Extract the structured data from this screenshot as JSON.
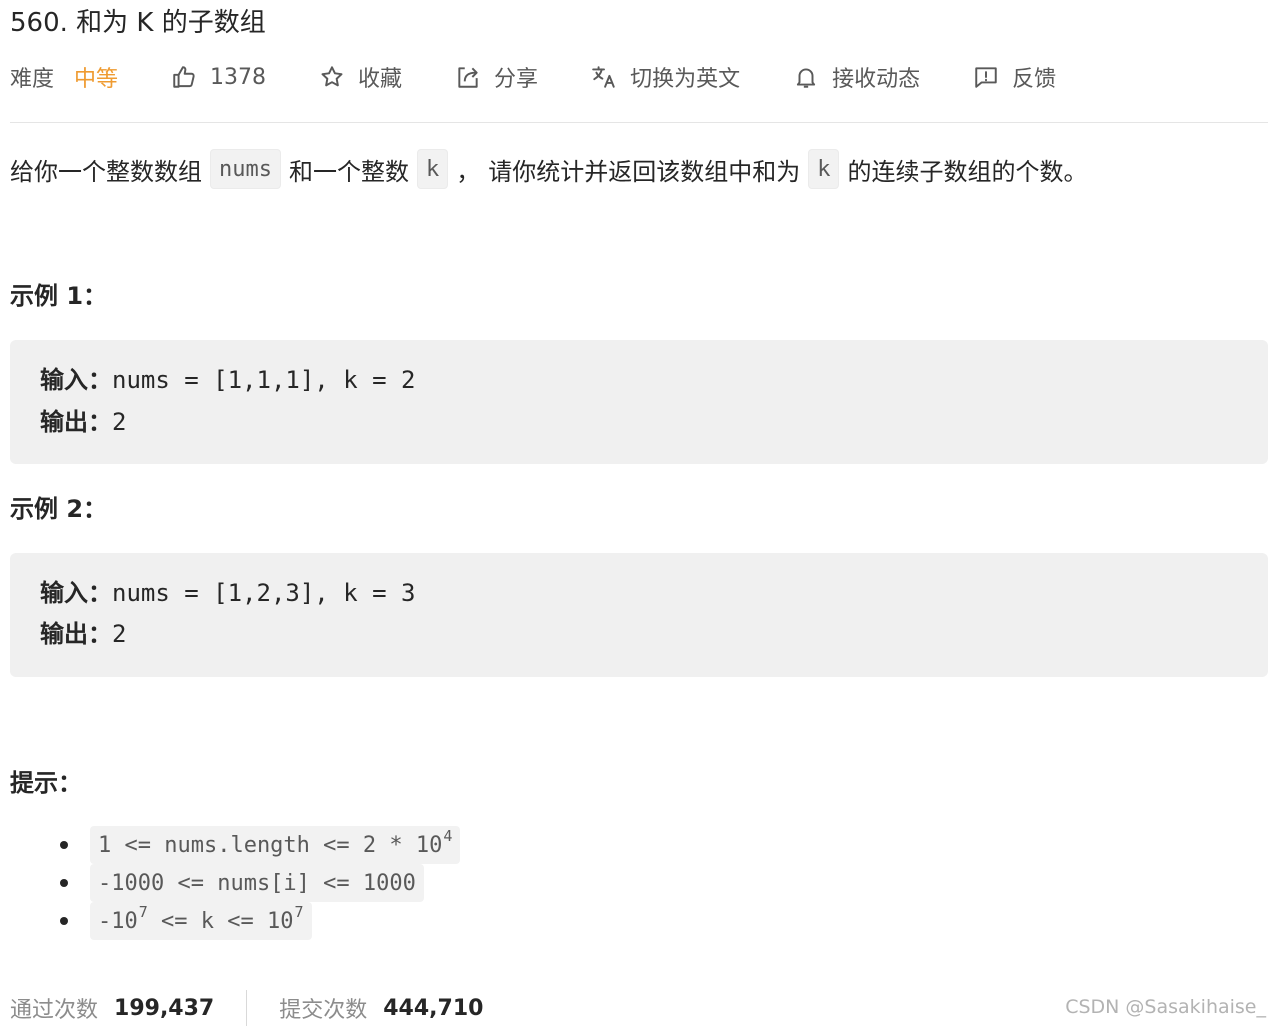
{
  "problem": {
    "title": "560. 和为 K 的子数组"
  },
  "toolbar": {
    "difficulty_label": "难度",
    "difficulty_value": "中等",
    "difficulty_color": "#ef9b31",
    "like_count": "1378",
    "like_icon": "thumbs-up-icon",
    "favorite_label": "收藏",
    "favorite_icon": "star-icon",
    "share_label": "分享",
    "share_icon": "share-icon",
    "translate_label": "切换为英文",
    "translate_icon": "translate-icon",
    "subscribe_label": "接收动态",
    "subscribe_icon": "bell-icon",
    "feedback_label": "反馈",
    "feedback_icon": "feedback-icon"
  },
  "description": {
    "part1": "给你一个整数数组",
    "code1": "nums",
    "part2": "和一个整数",
    "code2": "k",
    "part3": "，",
    "part4": "请你统计并返回该数组中和为",
    "code3": "k",
    "part5": "的连续子数组的个数。"
  },
  "examples": [
    {
      "heading": "示例 1：",
      "input_label": "输入：",
      "input": "nums = [1,1,1], k = 2",
      "output_label": "输出：",
      "output": "2"
    },
    {
      "heading": "示例 2：",
      "input_label": "输入：",
      "input": "nums = [1,2,3], k = 3",
      "output_label": "输出：",
      "output": "2"
    }
  ],
  "hints": {
    "heading": "提示：",
    "items": [
      {
        "text": "1 <= nums.length <= 2 * 10",
        "sup": "4",
        "rest": ""
      },
      {
        "text": "-1000 <= nums[i] <= 1000",
        "sup": "",
        "rest": ""
      },
      {
        "text": "-10",
        "sup": "7",
        "rest": " <= k <= 10",
        "sup2": "7"
      }
    ]
  },
  "stats": {
    "accepted_label": "通过次数",
    "accepted_value": "199,437",
    "submissions_label": "提交次数",
    "submissions_value": "444,710"
  },
  "watermark": "CSDN @Sasakihaise_"
}
